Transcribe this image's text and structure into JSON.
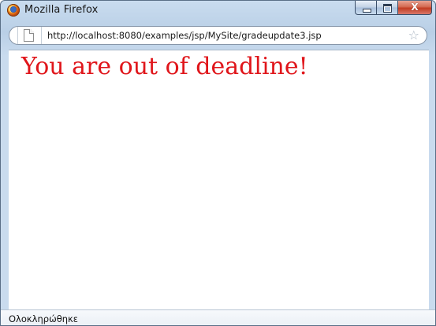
{
  "window": {
    "title": "Mozilla Firefox",
    "app_icon": "firefox-icon",
    "caption_buttons": {
      "minimize": "minimize-icon",
      "maximize": "maximize-icon",
      "close_glyph": "X"
    }
  },
  "toolbar": {
    "url": "http://localhost:8080/examples/jsp/MySite/gradeupdate3.jsp",
    "page_icon": "page-icon",
    "bookmark_star": "☆"
  },
  "page": {
    "message": "You are out of deadline!",
    "message_color": "#e0161b"
  },
  "statusbar": {
    "text": "Ολοκληρώθηκε"
  },
  "colors": {
    "titlebar": "#c9dcef",
    "close_button": "#c23c22"
  }
}
